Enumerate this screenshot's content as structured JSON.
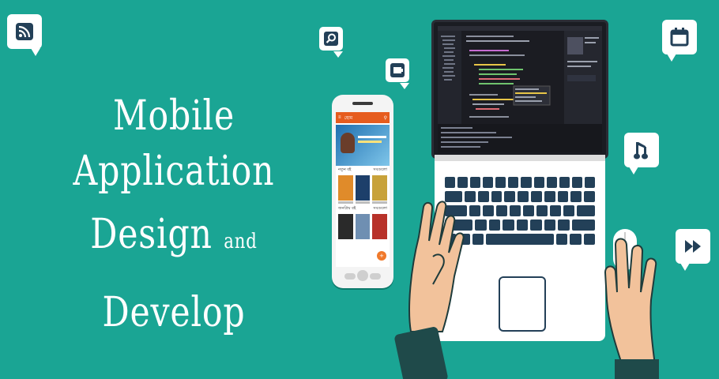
{
  "headline": {
    "line1": "Mobile Application",
    "line2_a": "Design",
    "line2_and": "and",
    "line2_b": "Develop"
  },
  "colors": {
    "background": "#1aa594",
    "icon_blue": "#234058",
    "phone_appbar": "#e65c1e",
    "skin": "#f2c29b",
    "sleeve": "#1f4a4a"
  },
  "icons": [
    "rss-icon",
    "search-icon",
    "battery-icon",
    "calendar-icon",
    "music-note-icon",
    "fast-forward-icon"
  ],
  "phone": {
    "appbar_title": "হোম",
    "section1": "নতুন বই",
    "section1_more": "সবগুলো",
    "section2": "জনপ্রিয় বই",
    "section2_more": "সবগুলো"
  }
}
